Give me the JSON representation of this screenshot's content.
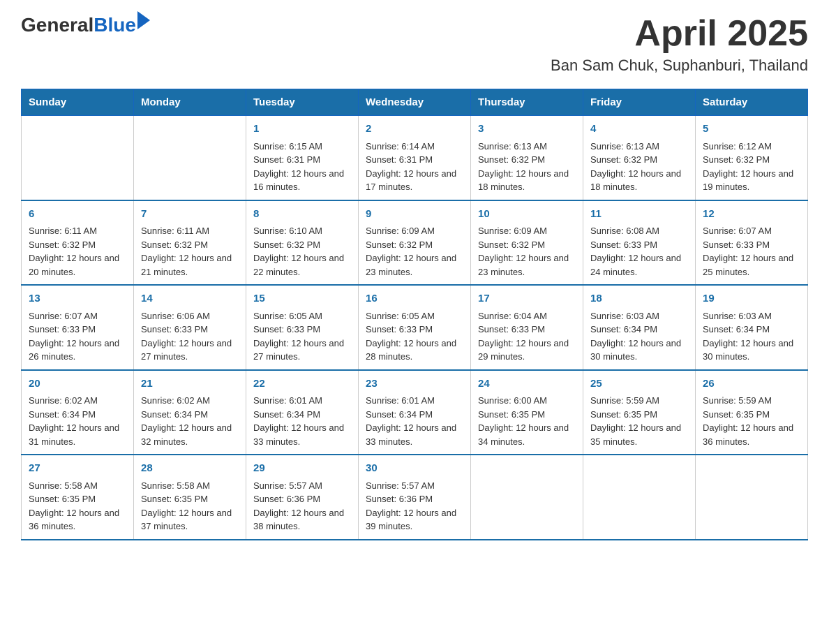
{
  "header": {
    "logo_general": "General",
    "logo_blue": "Blue",
    "title": "April 2025",
    "subtitle": "Ban Sam Chuk, Suphanburi, Thailand"
  },
  "days_of_week": [
    "Sunday",
    "Monday",
    "Tuesday",
    "Wednesday",
    "Thursday",
    "Friday",
    "Saturday"
  ],
  "weeks": [
    [
      {
        "day": "",
        "sunrise": "",
        "sunset": "",
        "daylight": ""
      },
      {
        "day": "",
        "sunrise": "",
        "sunset": "",
        "daylight": ""
      },
      {
        "day": "1",
        "sunrise": "Sunrise: 6:15 AM",
        "sunset": "Sunset: 6:31 PM",
        "daylight": "Daylight: 12 hours and 16 minutes."
      },
      {
        "day": "2",
        "sunrise": "Sunrise: 6:14 AM",
        "sunset": "Sunset: 6:31 PM",
        "daylight": "Daylight: 12 hours and 17 minutes."
      },
      {
        "day": "3",
        "sunrise": "Sunrise: 6:13 AM",
        "sunset": "Sunset: 6:32 PM",
        "daylight": "Daylight: 12 hours and 18 minutes."
      },
      {
        "day": "4",
        "sunrise": "Sunrise: 6:13 AM",
        "sunset": "Sunset: 6:32 PM",
        "daylight": "Daylight: 12 hours and 18 minutes."
      },
      {
        "day": "5",
        "sunrise": "Sunrise: 6:12 AM",
        "sunset": "Sunset: 6:32 PM",
        "daylight": "Daylight: 12 hours and 19 minutes."
      }
    ],
    [
      {
        "day": "6",
        "sunrise": "Sunrise: 6:11 AM",
        "sunset": "Sunset: 6:32 PM",
        "daylight": "Daylight: 12 hours and 20 minutes."
      },
      {
        "day": "7",
        "sunrise": "Sunrise: 6:11 AM",
        "sunset": "Sunset: 6:32 PM",
        "daylight": "Daylight: 12 hours and 21 minutes."
      },
      {
        "day": "8",
        "sunrise": "Sunrise: 6:10 AM",
        "sunset": "Sunset: 6:32 PM",
        "daylight": "Daylight: 12 hours and 22 minutes."
      },
      {
        "day": "9",
        "sunrise": "Sunrise: 6:09 AM",
        "sunset": "Sunset: 6:32 PM",
        "daylight": "Daylight: 12 hours and 23 minutes."
      },
      {
        "day": "10",
        "sunrise": "Sunrise: 6:09 AM",
        "sunset": "Sunset: 6:32 PM",
        "daylight": "Daylight: 12 hours and 23 minutes."
      },
      {
        "day": "11",
        "sunrise": "Sunrise: 6:08 AM",
        "sunset": "Sunset: 6:33 PM",
        "daylight": "Daylight: 12 hours and 24 minutes."
      },
      {
        "day": "12",
        "sunrise": "Sunrise: 6:07 AM",
        "sunset": "Sunset: 6:33 PM",
        "daylight": "Daylight: 12 hours and 25 minutes."
      }
    ],
    [
      {
        "day": "13",
        "sunrise": "Sunrise: 6:07 AM",
        "sunset": "Sunset: 6:33 PM",
        "daylight": "Daylight: 12 hours and 26 minutes."
      },
      {
        "day": "14",
        "sunrise": "Sunrise: 6:06 AM",
        "sunset": "Sunset: 6:33 PM",
        "daylight": "Daylight: 12 hours and 27 minutes."
      },
      {
        "day": "15",
        "sunrise": "Sunrise: 6:05 AM",
        "sunset": "Sunset: 6:33 PM",
        "daylight": "Daylight: 12 hours and 27 minutes."
      },
      {
        "day": "16",
        "sunrise": "Sunrise: 6:05 AM",
        "sunset": "Sunset: 6:33 PM",
        "daylight": "Daylight: 12 hours and 28 minutes."
      },
      {
        "day": "17",
        "sunrise": "Sunrise: 6:04 AM",
        "sunset": "Sunset: 6:33 PM",
        "daylight": "Daylight: 12 hours and 29 minutes."
      },
      {
        "day": "18",
        "sunrise": "Sunrise: 6:03 AM",
        "sunset": "Sunset: 6:34 PM",
        "daylight": "Daylight: 12 hours and 30 minutes."
      },
      {
        "day": "19",
        "sunrise": "Sunrise: 6:03 AM",
        "sunset": "Sunset: 6:34 PM",
        "daylight": "Daylight: 12 hours and 30 minutes."
      }
    ],
    [
      {
        "day": "20",
        "sunrise": "Sunrise: 6:02 AM",
        "sunset": "Sunset: 6:34 PM",
        "daylight": "Daylight: 12 hours and 31 minutes."
      },
      {
        "day": "21",
        "sunrise": "Sunrise: 6:02 AM",
        "sunset": "Sunset: 6:34 PM",
        "daylight": "Daylight: 12 hours and 32 minutes."
      },
      {
        "day": "22",
        "sunrise": "Sunrise: 6:01 AM",
        "sunset": "Sunset: 6:34 PM",
        "daylight": "Daylight: 12 hours and 33 minutes."
      },
      {
        "day": "23",
        "sunrise": "Sunrise: 6:01 AM",
        "sunset": "Sunset: 6:34 PM",
        "daylight": "Daylight: 12 hours and 33 minutes."
      },
      {
        "day": "24",
        "sunrise": "Sunrise: 6:00 AM",
        "sunset": "Sunset: 6:35 PM",
        "daylight": "Daylight: 12 hours and 34 minutes."
      },
      {
        "day": "25",
        "sunrise": "Sunrise: 5:59 AM",
        "sunset": "Sunset: 6:35 PM",
        "daylight": "Daylight: 12 hours and 35 minutes."
      },
      {
        "day": "26",
        "sunrise": "Sunrise: 5:59 AM",
        "sunset": "Sunset: 6:35 PM",
        "daylight": "Daylight: 12 hours and 36 minutes."
      }
    ],
    [
      {
        "day": "27",
        "sunrise": "Sunrise: 5:58 AM",
        "sunset": "Sunset: 6:35 PM",
        "daylight": "Daylight: 12 hours and 36 minutes."
      },
      {
        "day": "28",
        "sunrise": "Sunrise: 5:58 AM",
        "sunset": "Sunset: 6:35 PM",
        "daylight": "Daylight: 12 hours and 37 minutes."
      },
      {
        "day": "29",
        "sunrise": "Sunrise: 5:57 AM",
        "sunset": "Sunset: 6:36 PM",
        "daylight": "Daylight: 12 hours and 38 minutes."
      },
      {
        "day": "30",
        "sunrise": "Sunrise: 5:57 AM",
        "sunset": "Sunset: 6:36 PM",
        "daylight": "Daylight: 12 hours and 39 minutes."
      },
      {
        "day": "",
        "sunrise": "",
        "sunset": "",
        "daylight": ""
      },
      {
        "day": "",
        "sunrise": "",
        "sunset": "",
        "daylight": ""
      },
      {
        "day": "",
        "sunrise": "",
        "sunset": "",
        "daylight": ""
      }
    ]
  ]
}
